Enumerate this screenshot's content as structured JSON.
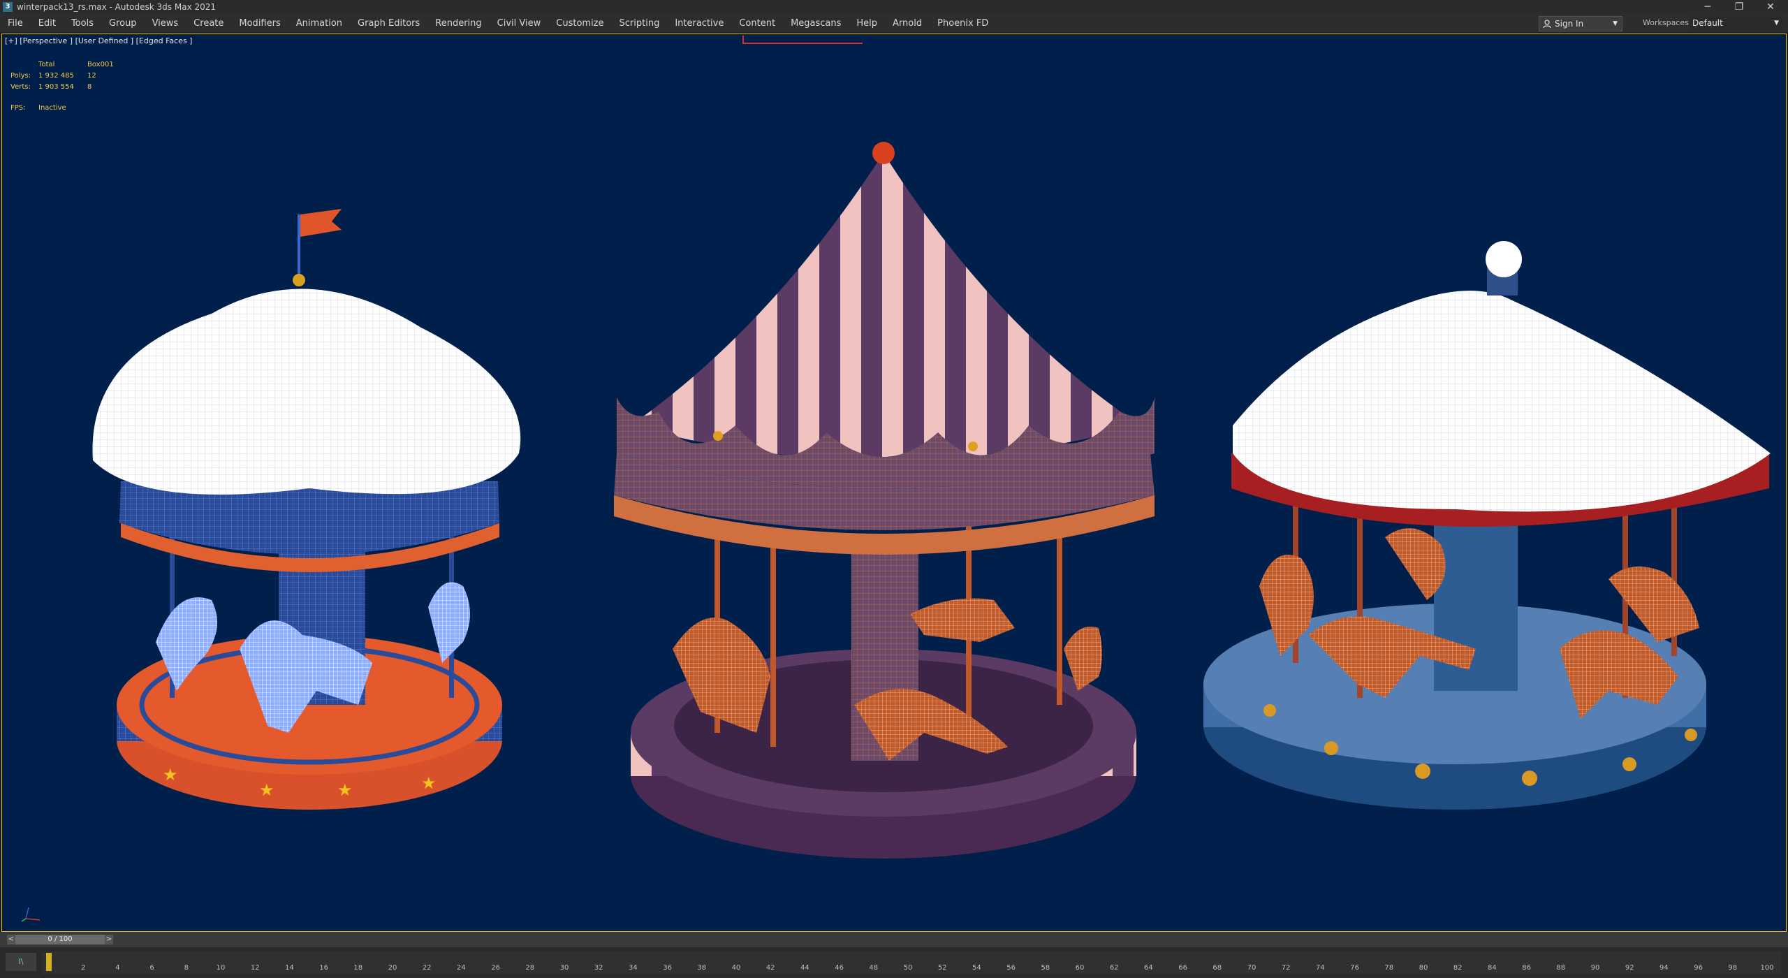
{
  "window": {
    "app_icon": "3",
    "title": "winterpack13_rs.max - Autodesk 3ds Max 2021",
    "controls": {
      "minimize": "─",
      "restore": "❐",
      "close": "✕"
    }
  },
  "menubar": {
    "items": [
      "File",
      "Edit",
      "Tools",
      "Group",
      "Views",
      "Create",
      "Modifiers",
      "Animation",
      "Graph Editors",
      "Rendering",
      "Civil View",
      "Customize",
      "Scripting",
      "Interactive",
      "Content",
      "Megascans",
      "Help",
      "Arnold",
      "Phoenix FD"
    ],
    "sign_in": "Sign In",
    "workspaces_label": "Workspaces:",
    "workspace_value": "Default"
  },
  "viewport": {
    "label": "[+] [Perspective ] [User Defined ] [Edged Faces ]",
    "stats": {
      "header": [
        "",
        "Total",
        "Box001"
      ],
      "rows": [
        [
          "Polys:",
          "1 932 485",
          "12"
        ],
        [
          "Verts:",
          "1 903 554",
          "8"
        ]
      ],
      "fps_label": "FPS:",
      "fps_value": "Inactive"
    },
    "background_color": "#00204b",
    "active_border_color": "#f2c31d"
  },
  "timeline": {
    "slider_label": "0 / 100",
    "prev": "<",
    "next": ">",
    "current_frame": 0,
    "key_button": "I\\",
    "ticks": [
      "2",
      "4",
      "6",
      "8",
      "10",
      "12",
      "14",
      "16",
      "18",
      "20",
      "22",
      "24",
      "26",
      "28",
      "30",
      "32",
      "34",
      "36",
      "38",
      "40",
      "42",
      "44",
      "46",
      "48",
      "50",
      "52",
      "54",
      "56",
      "58",
      "60",
      "62",
      "64",
      "66",
      "68",
      "70",
      "72",
      "74",
      "76",
      "78",
      "80",
      "82",
      "84",
      "86",
      "88",
      "90",
      "92",
      "94",
      "96",
      "98",
      "100"
    ]
  },
  "scene": {
    "objects": [
      "carousel-snow-blue",
      "carousel-circus-purple",
      "carousel-snow-red"
    ]
  }
}
